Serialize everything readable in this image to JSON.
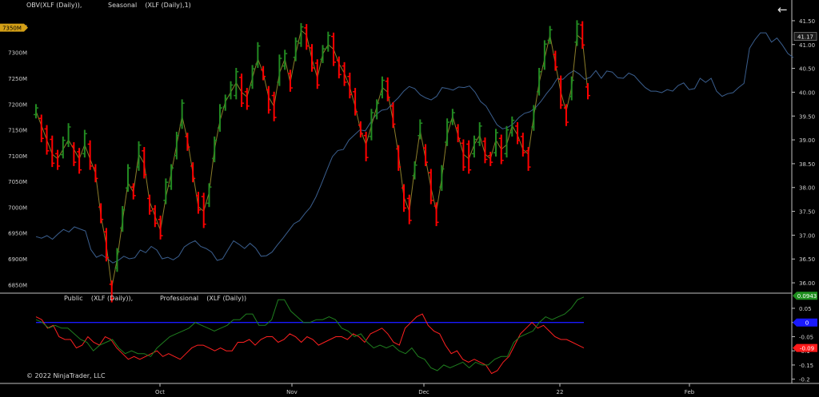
{
  "upper_panel": {
    "obv_label": "OBV(XLF (Daily)),",
    "seasonal_label": "Seasonal    (XLF (Daily),1)"
  },
  "lower_panel": {
    "public_label": "Public    (XLF (Daily)),",
    "professional_label": "Professional    (XLF (Daily))"
  },
  "copyright": "© 2022 NinjaTrader, LLC",
  "nav": {
    "back_icon": "arrow-left-icon"
  },
  "colors": {
    "background": "#000000",
    "up_bar": "#228b22",
    "down_bar": "#ff0000",
    "obv_line": "#3b5f8f",
    "seasonal_line": "#8b7d2a",
    "public_line": "#ff2020",
    "professional_line": "#1f7f1f",
    "zero_line": "#1a1aff",
    "left_badge": "#d4a017"
  },
  "chart_data": [
    {
      "type": "line",
      "title": "",
      "x_ticks": [
        "Oct",
        "Nov",
        "Dec",
        "22",
        "Feb"
      ],
      "left_axis": {
        "ticks": [
          "6850M",
          "6900M",
          "6950M",
          "7000M",
          "7050M",
          "7100M",
          "7150M",
          "7200M",
          "7250M",
          "7300M",
          "7350M"
        ],
        "range": [
          6835,
          7380
        ],
        "badge": "7350M"
      },
      "right_axis": {
        "ticks": [
          "36.00",
          "36.50",
          "37.00",
          "37.50",
          "38.00",
          "38.50",
          "39.00",
          "39.50",
          "40.00",
          "40.50",
          "41.00",
          "41.50"
        ],
        "range": [
          35.8,
          41.7
        ],
        "badge": "41.17"
      },
      "series": [
        {
          "name": "OBV",
          "axis": "left",
          "values": [
            6943,
            6940,
            6945,
            6938,
            6948,
            6957,
            6952,
            6962,
            6958,
            6954,
            6918,
            6903,
            6908,
            6900,
            6892,
            6897,
            6905,
            6900,
            6902,
            6917,
            6912,
            6924,
            6917,
            6900,
            6903,
            6898,
            6905,
            6923,
            6930,
            6935,
            6924,
            6920,
            6913,
            6897,
            6900,
            6918,
            6935,
            6928,
            6920,
            6930,
            6921,
            6905,
            6906,
            6913,
            6927,
            6940,
            6954,
            6968,
            6974,
            6988,
            7000,
            7020,
            7045,
            7072,
            7098,
            7110,
            7112,
            7130,
            7140,
            7150,
            7148,
            7165,
            7180,
            7188,
            7190,
            7202,
            7212,
            7225,
            7234,
            7230,
            7218,
            7212,
            7208,
            7215,
            7232,
            7230,
            7227,
            7233,
            7232,
            7235,
            7223,
            7205,
            7196,
            7178,
            7160,
            7152,
            7155,
            7162,
            7174,
            7182,
            7185,
            7193,
            7205,
            7220,
            7233,
            7250,
            7248,
            7258,
            7265,
            7258,
            7248,
            7252,
            7265,
            7250,
            7264,
            7262,
            7251,
            7250,
            7260,
            7255,
            7243,
            7232,
            7225,
            7225,
            7222,
            7228,
            7225,
            7236,
            7241,
            7228,
            7230,
            7250,
            7242,
            7250,
            7225,
            7215,
            7220,
            7222,
            7232,
            7240,
            7308,
            7325,
            7338,
            7338,
            7320,
            7328,
            7314,
            7298,
            7290
          ]
        },
        {
          "name": "Seasonal",
          "axis": "right",
          "values": [
            39.6,
            39.3,
            39.0,
            38.7,
            38.6,
            38.8,
            39.0,
            38.8,
            38.6,
            38.9,
            38.6,
            38.3,
            37.4,
            36.8,
            35.9,
            36.5,
            37.3,
            38.1,
            37.9,
            38.7,
            38.5,
            37.7,
            37.4,
            37.1,
            37.8,
            38.3,
            38.9,
            39.5,
            39.0,
            38.3,
            37.6,
            37.5,
            37.9,
            38.8,
            39.4,
            39.8,
            40.0,
            40.2,
            40.0,
            39.9,
            40.3,
            40.7,
            40.4,
            39.9,
            39.7,
            40.4,
            40.7,
            40.2,
            40.8,
            41.3,
            41.2,
            40.7,
            40.3,
            40.8,
            41.0,
            40.9,
            40.6,
            40.4,
            40.1,
            39.7,
            39.2,
            38.9,
            39.3,
            39.7,
            40.1,
            40.0,
            39.4,
            38.7,
            37.8,
            37.5,
            38.4,
            39.2,
            38.6,
            38.0,
            37.5,
            38.2,
            39.1,
            39.5,
            39.1,
            38.7,
            38.6,
            38.9,
            39.1,
            38.7,
            38.6,
            39.0,
            38.8,
            38.9,
            39.3,
            39.1,
            38.8,
            38.7,
            39.5,
            40.2,
            40.7,
            41.2,
            40.6,
            40.0,
            39.6,
            40.1,
            41.2,
            41.1,
            40.0
          ]
        }
      ]
    },
    {
      "type": "line",
      "title": "",
      "right_axis": {
        "ticks": [
          "0.05",
          "0",
          "-0.05",
          "-0.1",
          "-0.15",
          "-0.2"
        ],
        "range": [
          -0.215,
          0.095
        ],
        "badges": [
          "0.0943",
          "0",
          "-0.09"
        ]
      },
      "zero_line": 0,
      "series": [
        {
          "name": "Public",
          "values": [
            0.02,
            0.01,
            -0.02,
            -0.01,
            -0.05,
            -0.06,
            -0.06,
            -0.09,
            -0.08,
            -0.05,
            -0.07,
            -0.08,
            -0.05,
            -0.06,
            -0.09,
            -0.11,
            -0.13,
            -0.12,
            -0.13,
            -0.12,
            -0.11,
            -0.1,
            -0.12,
            -0.11,
            -0.12,
            -0.13,
            -0.11,
            -0.09,
            -0.08,
            -0.08,
            -0.09,
            -0.1,
            -0.09,
            -0.1,
            -0.1,
            -0.07,
            -0.07,
            -0.06,
            -0.08,
            -0.06,
            -0.05,
            -0.05,
            -0.07,
            -0.06,
            -0.04,
            -0.05,
            -0.07,
            -0.05,
            -0.06,
            -0.08,
            -0.07,
            -0.06,
            -0.05,
            -0.05,
            -0.06,
            -0.04,
            -0.05,
            -0.07,
            -0.04,
            -0.03,
            -0.02,
            -0.04,
            -0.07,
            -0.08,
            -0.02,
            0.0,
            0.02,
            0.03,
            -0.01,
            -0.03,
            -0.04,
            -0.08,
            -0.11,
            -0.1,
            -0.13,
            -0.14,
            -0.13,
            -0.14,
            -0.15,
            -0.18,
            -0.17,
            -0.14,
            -0.12,
            -0.08,
            -0.04,
            -0.02,
            0.0,
            -0.02,
            -0.01,
            -0.03,
            -0.05,
            -0.06,
            -0.06,
            -0.07,
            -0.08,
            -0.09
          ]
        },
        {
          "name": "Professional",
          "values": [
            0.01,
            0.0,
            -0.02,
            -0.01,
            -0.02,
            -0.02,
            -0.04,
            -0.06,
            -0.07,
            -0.1,
            -0.08,
            -0.07,
            -0.06,
            -0.09,
            -0.11,
            -0.1,
            -0.11,
            -0.11,
            -0.12,
            -0.09,
            -0.07,
            -0.05,
            -0.04,
            -0.03,
            -0.02,
            0.0,
            -0.01,
            -0.02,
            -0.03,
            -0.02,
            -0.01,
            0.01,
            0.01,
            0.03,
            0.03,
            -0.01,
            -0.01,
            0.01,
            0.08,
            0.08,
            0.04,
            0.02,
            0.0,
            0.0,
            0.01,
            0.01,
            0.02,
            0.01,
            -0.02,
            -0.03,
            -0.05,
            -0.04,
            -0.07,
            -0.09,
            -0.08,
            -0.09,
            -0.08,
            -0.1,
            -0.11,
            -0.09,
            -0.12,
            -0.13,
            -0.16,
            -0.17,
            -0.15,
            -0.16,
            -0.15,
            -0.14,
            -0.16,
            -0.14,
            -0.15,
            -0.15,
            -0.13,
            -0.12,
            -0.12,
            -0.07,
            -0.05,
            -0.04,
            -0.03,
            0.0,
            0.02,
            0.01,
            0.02,
            0.03,
            0.05,
            0.08,
            0.09
          ]
        }
      ]
    }
  ]
}
